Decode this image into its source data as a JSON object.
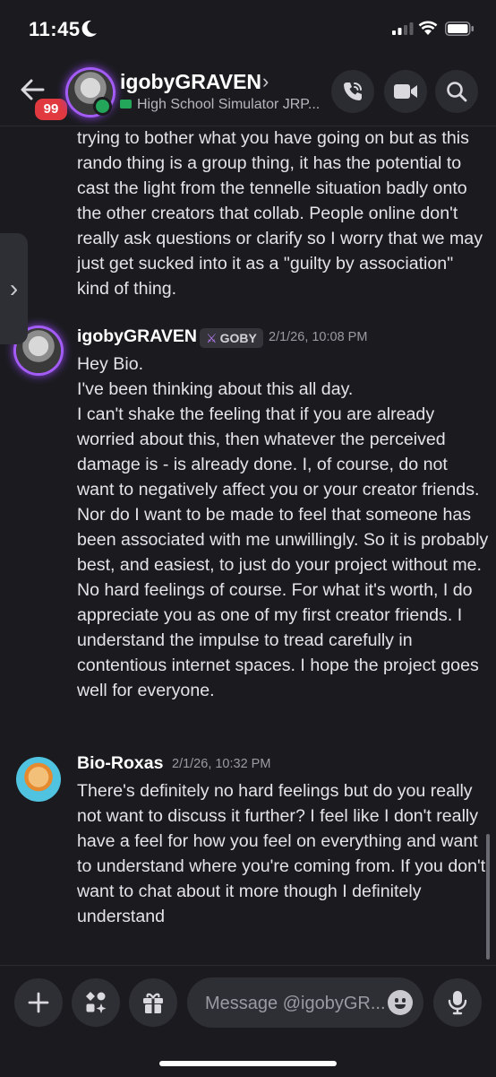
{
  "status_bar": {
    "time": "11:45"
  },
  "header": {
    "unread_badge": "99",
    "name": "igobyGRAVEN",
    "chevron": "›",
    "subtitle": "High School Simulator JRP..."
  },
  "messages": {
    "continuation_text": "trying to bother what you have going on but as this rando thing is a group thing, it has the potential to cast the light from the tennelle situation badly onto the other creators that collab. People online don't really ask questions or clarify so I worry that we may just get sucked into it as a \"guilty by association\" kind of thing.",
    "list": [
      {
        "author": "igobyGRAVEN",
        "tag": "GOBY",
        "timestamp": "2/1/26, 10:08 PM",
        "text": "Hey Bio.\nI've been thinking about this all day.\nI can't shake the feeling that if you are already worried about this, then whatever the perceived damage is - is already done. I, of course, do not want to negatively affect you or your creator friends. Nor do I want to be made to feel that someone has been associated with me unwillingly. So it is probably best, and easiest, to just do your project without me. No hard feelings of course. For what it's worth, I do appreciate you as one of my first creator friends.  I understand the impulse to tread carefully in contentious internet spaces. I hope the project goes well for everyone."
      },
      {
        "author": "Bio-Roxas",
        "timestamp": "2/1/26, 10:32 PM",
        "text": "There's definitely no hard feelings but do you really not want to discuss it further? I feel like I don't really have a feel for how you feel on everything and want to understand where you're coming from. If you don't want to chat about it more though I definitely understand"
      }
    ]
  },
  "composer": {
    "placeholder": "Message @igobyGR..."
  },
  "side_tab": {
    "glyph": "›"
  },
  "icons": {
    "moon": "moon-icon",
    "signal": "signal-icon",
    "wifi": "wifi-icon",
    "battery": "battery-icon",
    "back": "back-arrow-icon",
    "call": "phone-call-icon",
    "video": "video-camera-icon",
    "search": "search-icon",
    "plus": "plus-icon",
    "apps": "apps-icon",
    "gift": "gift-icon",
    "emoji": "emoji-icon",
    "mic": "microphone-icon"
  },
  "colors": {
    "background": "#1b1b1f",
    "online": "#23a55a",
    "badge": "#e0393f",
    "avatar_ring": "#a35cf5"
  }
}
